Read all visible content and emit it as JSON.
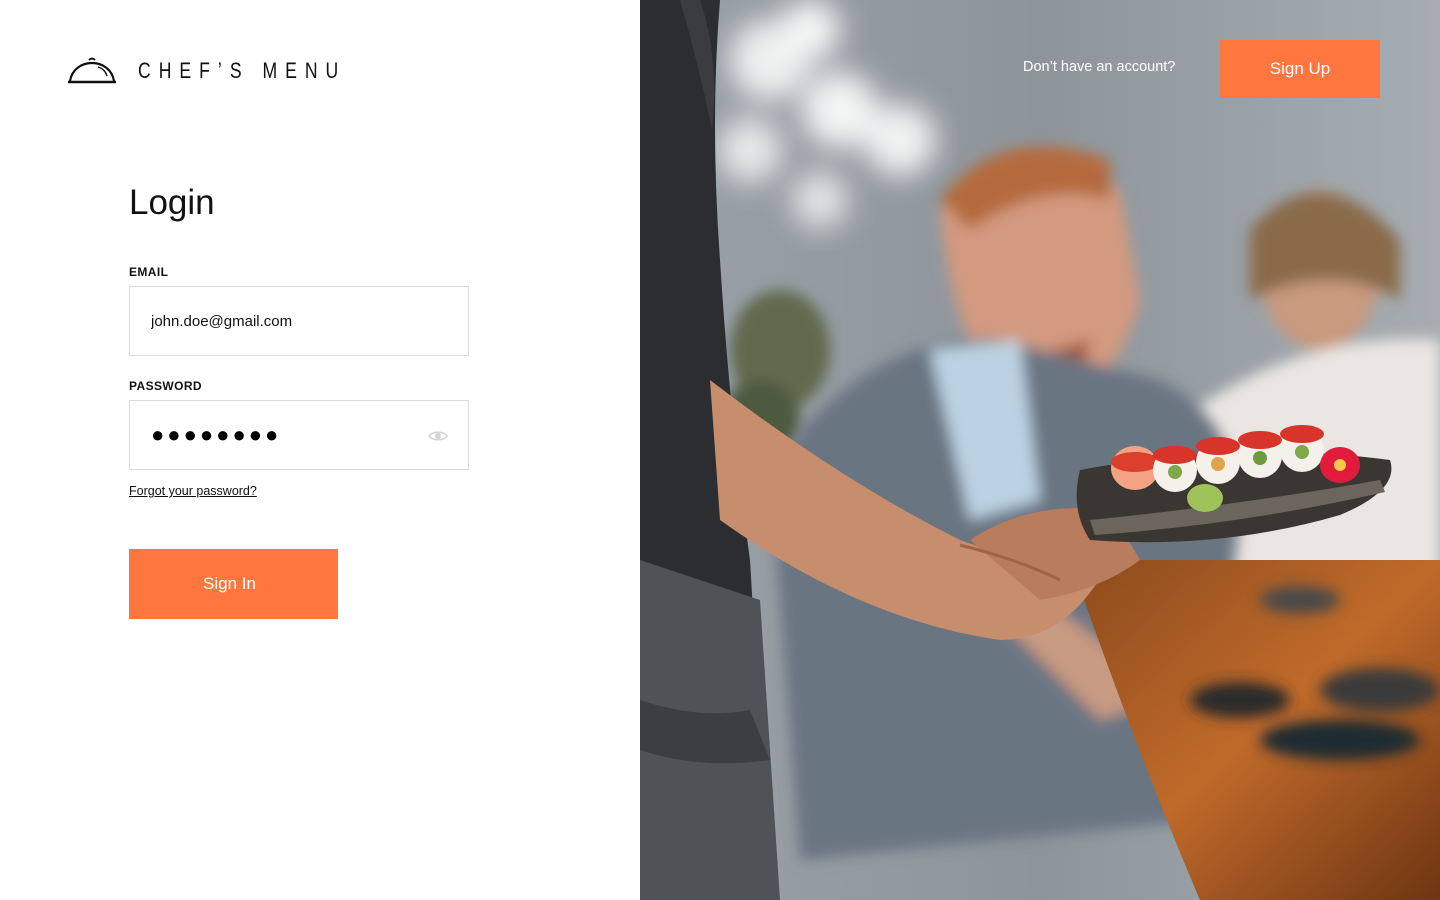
{
  "brand": {
    "name": "CHEF’S MENU",
    "icon": "cloche-icon"
  },
  "login": {
    "title": "Login",
    "email_label": "EMAIL",
    "email_value": "john.doe@gmail.com",
    "password_label": "PASSWORD",
    "password_value": "●●●●●●●●",
    "password_toggle_icon": "eye-icon",
    "forgot_link": "Forgot your password?",
    "signin_label": "Sign In"
  },
  "header_right": {
    "account_prompt": "Don’t have an account?",
    "signup_label": "Sign Up"
  },
  "hero_image": {
    "subject": "restaurant-scene-waiter-serving-sushi-platter"
  },
  "colors": {
    "accent": "#ff763f",
    "text": "#111111",
    "field_border": "#dcdcdc",
    "background": "#ffffff"
  }
}
